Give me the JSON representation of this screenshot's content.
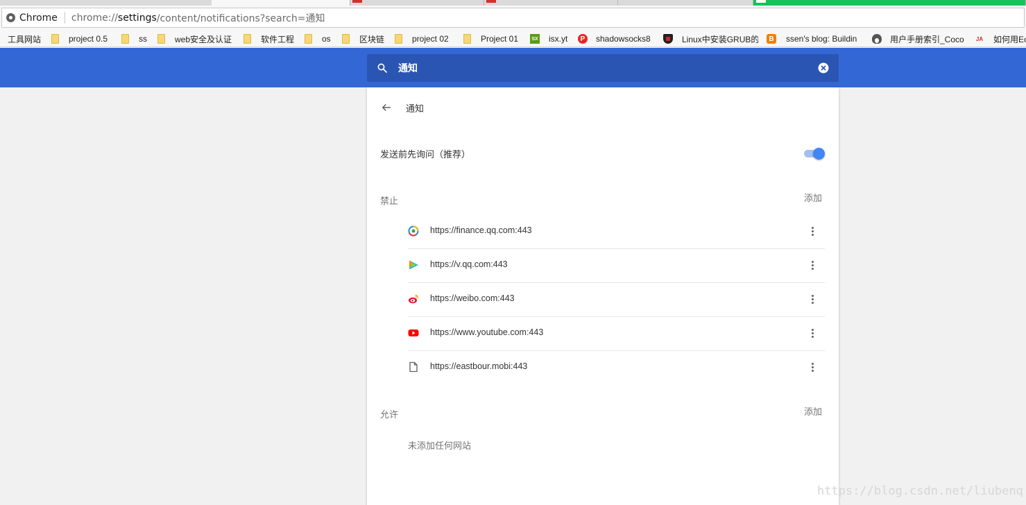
{
  "browser": {
    "app_name": "Chrome",
    "url_scheme": "chrome://",
    "url_host": "settings",
    "url_path": "/content/notifications?search=通知"
  },
  "bookmarks": [
    {
      "label": "工具网站",
      "icon": "none"
    },
    {
      "label": "project 0.5",
      "icon": "folder-icon"
    },
    {
      "label": "ss",
      "icon": "folder-icon"
    },
    {
      "label": "web安全及认证",
      "icon": "folder-icon"
    },
    {
      "label": "软件工程",
      "icon": "folder-icon"
    },
    {
      "label": "os",
      "icon": "folder-icon"
    },
    {
      "label": "区块链",
      "icon": "folder-icon"
    },
    {
      "label": "project 02",
      "icon": "folder-icon"
    },
    {
      "label": "Project 01",
      "icon": "folder-icon"
    },
    {
      "label": "isx.yt",
      "icon": "green-sx-icon"
    },
    {
      "label": "shadowsocks8",
      "icon": "red-p-icon"
    },
    {
      "label": "Linux中安装GRUB的",
      "icon": "shield-icon"
    },
    {
      "label": "ssen's blog: Buildin",
      "icon": "blogger-icon"
    },
    {
      "label": "用户手册索引_Coco",
      "icon": "penguin-icon"
    },
    {
      "label": "如何用Ec",
      "icon": "ja-icon"
    }
  ],
  "search": {
    "query": "通知"
  },
  "notifications": {
    "title": "通知",
    "ask_label": "发送前先询问（推荐）",
    "ask_enabled": true,
    "block": {
      "label": "禁止",
      "add_label": "添加",
      "sites": [
        {
          "url": "https://finance.qq.com:443",
          "icon": "qq-finance-icon"
        },
        {
          "url": "https://v.qq.com:443",
          "icon": "tencent-video-icon"
        },
        {
          "url": "https://weibo.com:443",
          "icon": "weibo-icon"
        },
        {
          "url": "https://www.youtube.com:443",
          "icon": "youtube-icon"
        },
        {
          "url": "https://eastbour.mobi:443",
          "icon": "document-icon"
        }
      ]
    },
    "allow": {
      "label": "允许",
      "add_label": "添加",
      "empty_message": "未添加任何网站"
    }
  },
  "colors": {
    "header_blue": "#3367d6",
    "search_blue": "#2a55b2",
    "toggle_on": "#4285f4"
  },
  "watermark": "https://blog.csdn.net/liubenq"
}
